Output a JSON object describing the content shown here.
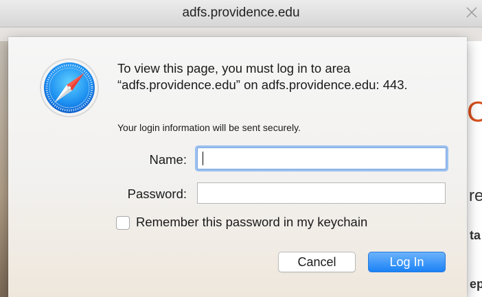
{
  "window": {
    "title": "adfs.providence.edu",
    "close_icon": "close-x-icon"
  },
  "background_page": {
    "glyph_1": "O",
    "glyph_2": "re",
    "glyph_3": "ta",
    "glyph_4": "ep"
  },
  "dialog": {
    "icon": "safari-compass-icon",
    "message": "To view this page, you must log in to area “adfs.providence.edu” on adfs.providence.edu: 443.",
    "secure_note": "Your login information will be sent securely.",
    "name_label": "Name:",
    "name_value": "",
    "password_label": "Password:",
    "password_value": "",
    "remember_label": "Remember this password in my keychain",
    "remember_checked": false,
    "cancel_label": "Cancel",
    "login_label": "Log In"
  },
  "colors": {
    "login_button": "#1b82f6",
    "focus_ring": "#9ac0ef",
    "accent_glyph": "#d9501e"
  }
}
